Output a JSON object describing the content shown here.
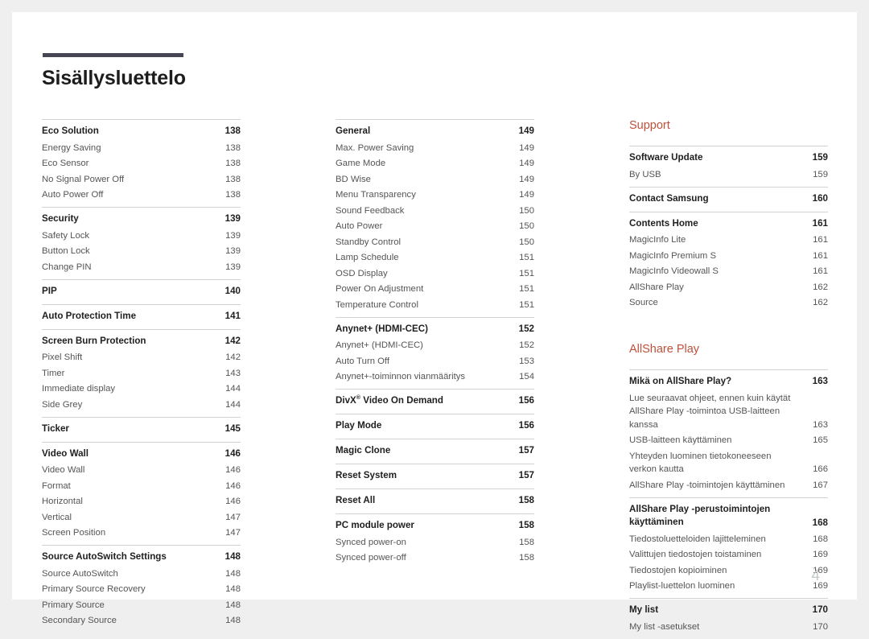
{
  "document": {
    "title": "Sisällysluettelo",
    "footer_page_number": "4",
    "accent_color": "#c0503c",
    "rule_color": "#454553"
  },
  "columns": [
    {
      "groups": [
        {
          "heading": {
            "label": "Eco Solution",
            "page": "138"
          },
          "entries": [
            {
              "label": "Energy Saving",
              "page": "138"
            },
            {
              "label": "Eco Sensor",
              "page": "138"
            },
            {
              "label": "No Signal Power Off",
              "page": "138"
            },
            {
              "label": "Auto Power Off",
              "page": "138"
            }
          ]
        },
        {
          "heading": {
            "label": "Security",
            "page": "139"
          },
          "entries": [
            {
              "label": "Safety Lock",
              "page": "139"
            },
            {
              "label": "Button Lock",
              "page": "139"
            },
            {
              "label": "Change PIN",
              "page": "139"
            }
          ]
        },
        {
          "heading": {
            "label": "PIP",
            "page": "140"
          },
          "entries": []
        },
        {
          "heading": {
            "label": "Auto Protection Time",
            "page": "141"
          },
          "entries": []
        },
        {
          "heading": {
            "label": "Screen Burn Protection",
            "page": "142"
          },
          "entries": [
            {
              "label": "Pixel Shift",
              "page": "142"
            },
            {
              "label": "Timer",
              "page": "143"
            },
            {
              "label": "Immediate display",
              "page": "144"
            },
            {
              "label": "Side Grey",
              "page": "144"
            }
          ]
        },
        {
          "heading": {
            "label": "Ticker",
            "page": "145"
          },
          "entries": []
        },
        {
          "heading": {
            "label": "Video Wall",
            "page": "146"
          },
          "entries": [
            {
              "label": "Video Wall",
              "page": "146"
            },
            {
              "label": "Format",
              "page": "146"
            },
            {
              "label": "Horizontal",
              "page": "146"
            },
            {
              "label": "Vertical",
              "page": "147"
            },
            {
              "label": "Screen Position",
              "page": "147"
            }
          ]
        },
        {
          "heading": {
            "label": "Source AutoSwitch Settings",
            "page": "148"
          },
          "entries": [
            {
              "label": "Source AutoSwitch",
              "page": "148"
            },
            {
              "label": "Primary Source Recovery",
              "page": "148"
            },
            {
              "label": "Primary Source",
              "page": "148"
            },
            {
              "label": "Secondary Source",
              "page": "148"
            }
          ]
        }
      ]
    },
    {
      "groups": [
        {
          "heading": {
            "label": "General",
            "page": "149"
          },
          "entries": [
            {
              "label": "Max. Power Saving",
              "page": "149"
            },
            {
              "label": "Game Mode",
              "page": "149"
            },
            {
              "label": "BD Wise",
              "page": "149"
            },
            {
              "label": "Menu Transparency",
              "page": "149"
            },
            {
              "label": "Sound Feedback",
              "page": "150"
            },
            {
              "label": "Auto Power",
              "page": "150"
            },
            {
              "label": "Standby Control",
              "page": "150"
            },
            {
              "label": "Lamp Schedule",
              "page": "151"
            },
            {
              "label": "OSD Display",
              "page": "151"
            },
            {
              "label": "Power On Adjustment",
              "page": "151"
            },
            {
              "label": "Temperature Control",
              "page": "151"
            }
          ]
        },
        {
          "heading": {
            "label": "Anynet+ (HDMI-CEC)",
            "page": "152"
          },
          "entries": [
            {
              "label": "Anynet+ (HDMI-CEC)",
              "page": "152"
            },
            {
              "label": "Auto Turn Off",
              "page": "153"
            },
            {
              "label": "Anynet+-toiminnon vianmääritys",
              "page": "154"
            }
          ]
        },
        {
          "heading": {
            "label": "DivX® Video On Demand",
            "page": "156"
          },
          "entries": []
        },
        {
          "heading": {
            "label": "Play Mode",
            "page": "156"
          },
          "entries": []
        },
        {
          "heading": {
            "label": "Magic Clone",
            "page": "157"
          },
          "entries": []
        },
        {
          "heading": {
            "label": "Reset System",
            "page": "157"
          },
          "entries": []
        },
        {
          "heading": {
            "label": "Reset All",
            "page": "158"
          },
          "entries": []
        },
        {
          "heading": {
            "label": "PC module power",
            "page": "158"
          },
          "entries": [
            {
              "label": "Synced power-on",
              "page": "158"
            },
            {
              "label": "Synced power-off",
              "page": "158"
            }
          ]
        }
      ]
    },
    {
      "sections": [
        {
          "heading": "Support",
          "groups": [
            {
              "heading": {
                "label": "Software Update",
                "page": "159"
              },
              "entries": [
                {
                  "label": "By USB",
                  "page": "159"
                }
              ]
            },
            {
              "heading": {
                "label": "Contact Samsung",
                "page": "160"
              },
              "entries": []
            },
            {
              "heading": {
                "label": "Contents Home",
                "page": "161"
              },
              "entries": [
                {
                  "label": "MagicInfo Lite",
                  "page": "161"
                },
                {
                  "label": "MagicInfo Premium S",
                  "page": "161"
                },
                {
                  "label": "MagicInfo Videowall S",
                  "page": "161"
                },
                {
                  "label": "AllShare Play",
                  "page": "162"
                },
                {
                  "label": "Source",
                  "page": "162"
                }
              ]
            }
          ]
        },
        {
          "heading": "AllShare Play",
          "groups": [
            {
              "heading": {
                "label": "Mikä on AllShare Play?",
                "page": "163"
              },
              "entries": [
                {
                  "label": "Lue seuraavat ohjeet, ennen kuin käytät AllShare Play -toimintoa USB-laitteen kanssa",
                  "page": "163",
                  "wrap": true
                },
                {
                  "label": "USB-laitteen käyttäminen",
                  "page": "165"
                },
                {
                  "label": "Yhteyden luominen tietokoneeseen verkon kautta",
                  "page": "166",
                  "wrap": true
                },
                {
                  "label": "AllShare Play -toimintojen käyttäminen",
                  "page": "167"
                }
              ]
            },
            {
              "heading": {
                "label": "AllShare Play -perustoimintojen käyttäminen",
                "page": "168",
                "wrap": true
              },
              "entries": [
                {
                  "label": "Tiedostoluetteloiden lajitteleminen",
                  "page": "168"
                },
                {
                  "label": "Valittujen tiedostojen toistaminen",
                  "page": "169"
                },
                {
                  "label": "Tiedostojen kopioiminen",
                  "page": "169"
                },
                {
                  "label": "Playlist-luettelon luominen",
                  "page": "169"
                }
              ]
            },
            {
              "heading": {
                "label": "My list",
                "page": "170"
              },
              "entries": [
                {
                  "label": "My list -asetukset",
                  "page": "170"
                }
              ]
            }
          ]
        }
      ]
    }
  ]
}
